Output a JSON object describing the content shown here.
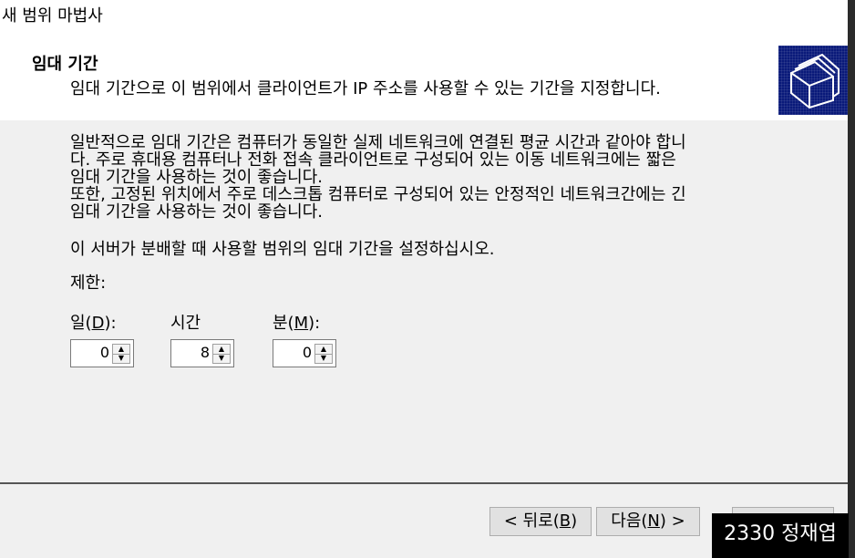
{
  "window": {
    "title": "새 범위 마법사"
  },
  "header": {
    "title": "임대 기간",
    "subtitle": "임대 기간으로 이 범위에서 클라이언트가 IP 주소를 사용할 수 있는 기간을 지정합니다.",
    "icon": "folders-icon"
  },
  "body": {
    "paragraph1": "일반적으로 임대 기간은 컴퓨터가 동일한 실제 네트워크에 연결된 평균 시간과 같아야 합니\n다. 주로 휴대용 컴퓨터나 전화 접속 클라이언트로 구성되어 있는 이동 네트워크에는 짧은\n임대 기간을 사용하는 것이 좋습니다.",
    "paragraph2": "또한, 고정된 위치에서 주로 데스크톱 컴퓨터로 구성되어 있는 안정적인 네트워크간에는 긴\n임대 기간을 사용하는 것이 좋습니다.",
    "instruction": "이 서버가 분배할 때 사용할 범위의 임대 기간을 설정하십시오.",
    "limit_label": "제한:"
  },
  "fields": {
    "days": {
      "label_pre": "일(",
      "accel": "D",
      "label_post": "):",
      "value": "0"
    },
    "hours": {
      "label": "시간",
      "value": "8"
    },
    "minutes": {
      "label_pre": "분(",
      "accel": "M",
      "label_post": "):",
      "value": "0"
    }
  },
  "buttons": {
    "back": {
      "pre": "< 뒤로(",
      "accel": "B",
      "post": ")"
    },
    "next": {
      "pre": "다음(",
      "accel": "N",
      "post": ") >"
    }
  },
  "overlay": {
    "badge": "2330 정재엽"
  },
  "colors": {
    "header_icon_bg": "#0a1a7a",
    "dialog_bg": "#f0f0f0"
  }
}
